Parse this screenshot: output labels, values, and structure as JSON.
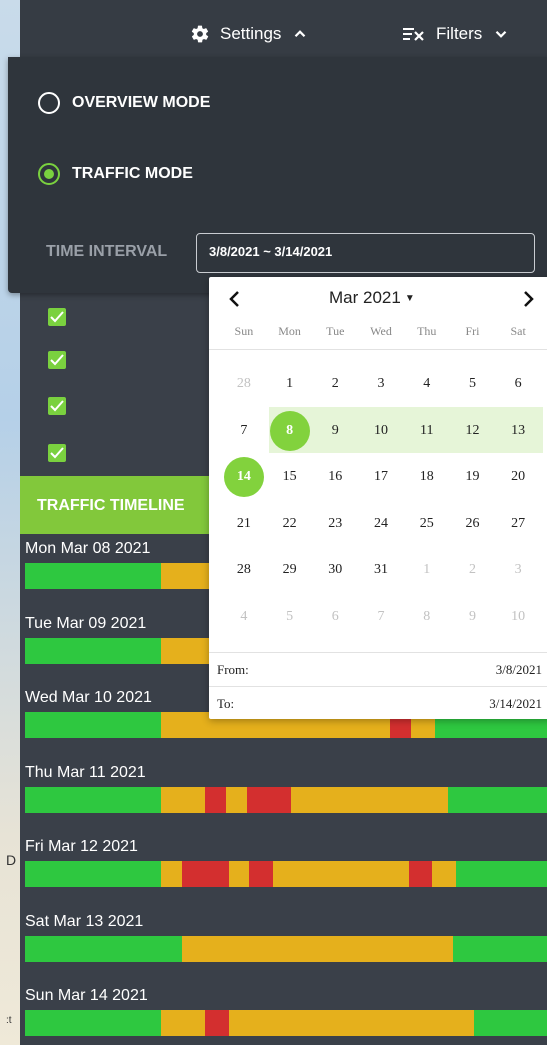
{
  "header": {
    "settings_label": "Settings",
    "filters_label": "Filters"
  },
  "settings": {
    "modes": [
      {
        "label": "OVERVIEW MODE",
        "checked": false
      },
      {
        "label": "TRAFFIC MODE",
        "checked": true
      }
    ],
    "time_interval_label": "TIME INTERVAL",
    "time_interval_value": "3/8/2021 ~ 3/14/2021"
  },
  "filters": {
    "checkboxes": [
      true,
      true,
      true,
      true
    ]
  },
  "calendar": {
    "month_label": "Mar 2021",
    "weekdays": [
      "Sun",
      "Mon",
      "Tue",
      "Wed",
      "Thu",
      "Fri",
      "Sat"
    ],
    "weeks": [
      [
        "28",
        "1",
        "2",
        "3",
        "4",
        "5",
        "6"
      ],
      [
        "7",
        "8",
        "9",
        "10",
        "11",
        "12",
        "13"
      ],
      [
        "14",
        "15",
        "16",
        "17",
        "18",
        "19",
        "20"
      ],
      [
        "21",
        "22",
        "23",
        "24",
        "25",
        "26",
        "27"
      ],
      [
        "28",
        "29",
        "30",
        "31",
        "1",
        "2",
        "3"
      ],
      [
        "4",
        "5",
        "6",
        "7",
        "8",
        "9",
        "10"
      ]
    ],
    "from_label": "From:",
    "from_value": "3/8/2021",
    "to_label": "To:",
    "to_value": "3/14/2021"
  },
  "timeline": {
    "title": "TRAFFIC TIMELINE",
    "colors": {
      "green": "#2ec840",
      "yellow": "#e5b01c",
      "red": "#d32f2f"
    },
    "days": [
      {
        "label": "Mon Mar 08 2021",
        "segments": [
          [
            "g",
            0.26
          ],
          [
            "y",
            0.74
          ]
        ]
      },
      {
        "label": "Tue Mar 09 2021",
        "segments": [
          [
            "g",
            0.26
          ],
          [
            "y",
            0.74
          ]
        ]
      },
      {
        "label": "Wed Mar 10 2021",
        "segments": [
          [
            "g",
            0.26
          ],
          [
            "y",
            0.44
          ],
          [
            "r",
            0.04
          ],
          [
            "y",
            0.045
          ],
          [
            "g",
            0.215
          ]
        ]
      },
      {
        "label": "Thu Mar 11 2021",
        "segments": [
          [
            "g",
            0.26
          ],
          [
            "y",
            0.085
          ],
          [
            "r",
            0.04
          ],
          [
            "y",
            0.04
          ],
          [
            "r",
            0.085
          ],
          [
            "y",
            0.3
          ],
          [
            "g",
            0.19
          ]
        ]
      },
      {
        "label": "Fri Mar 12 2021",
        "segments": [
          [
            "g",
            0.26
          ],
          [
            "y",
            0.04
          ],
          [
            "r",
            0.09
          ],
          [
            "y",
            0.04
          ],
          [
            "r",
            0.045
          ],
          [
            "y",
            0.26
          ],
          [
            "r",
            0.045
          ],
          [
            "y",
            0.045
          ],
          [
            "g",
            0.175
          ]
        ]
      },
      {
        "label": "Sat Mar 13 2021",
        "segments": [
          [
            "g",
            0.3
          ],
          [
            "y",
            0.52
          ],
          [
            "g",
            0.18
          ]
        ]
      },
      {
        "label": "Sun Mar 14 2021",
        "segments": [
          [
            "g",
            0.26
          ],
          [
            "y",
            0.085
          ],
          [
            "r",
            0.045
          ],
          [
            "y",
            0.47
          ],
          [
            "g",
            0.14
          ]
        ]
      }
    ]
  }
}
